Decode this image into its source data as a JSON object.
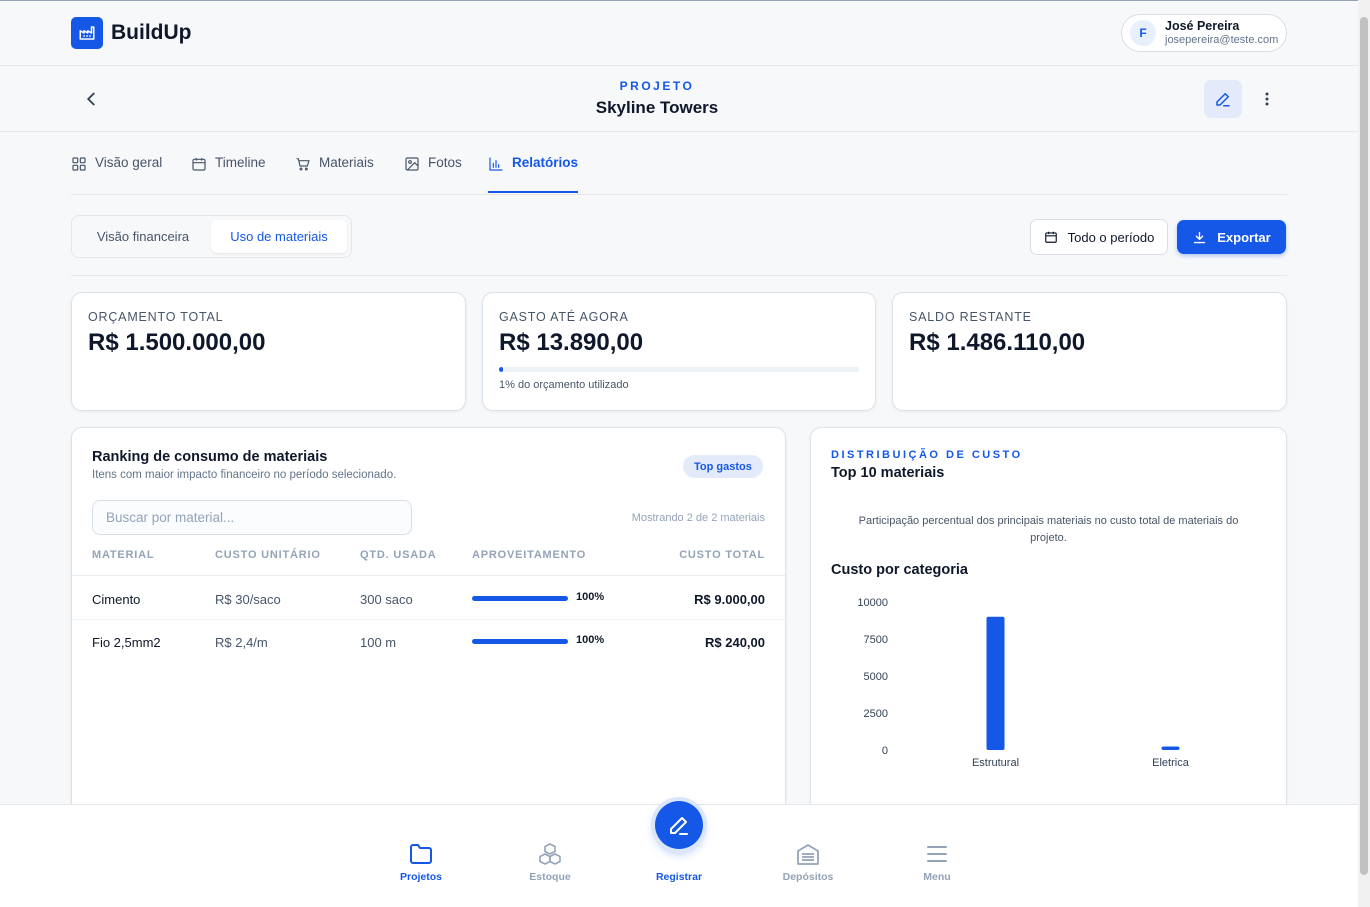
{
  "app": {
    "name": "BuildUp"
  },
  "user": {
    "initial": "F",
    "name": "José Pereira",
    "email": "josepereira@teste.com"
  },
  "project": {
    "label": "PROJETO",
    "name": "Skyline Towers"
  },
  "tabs": [
    {
      "label": "Visão geral",
      "icon": "grid-icon"
    },
    {
      "label": "Timeline",
      "icon": "calendar-icon"
    },
    {
      "label": "Materiais",
      "icon": "cart-icon"
    },
    {
      "label": "Fotos",
      "icon": "image-icon"
    },
    {
      "label": "Relatórios",
      "icon": "bar-chart-icon",
      "active": true
    }
  ],
  "segmented": {
    "options": [
      "Visão financeira",
      "Uso de materiais"
    ],
    "selected": "Uso de materiais"
  },
  "toolbar": {
    "period_label": "Todo o período",
    "export_label": "Exportar"
  },
  "kpis": [
    {
      "label": "ORÇAMENTO TOTAL",
      "value": "R$ 1.500.000,00"
    },
    {
      "label": "GASTO ATÉ AGORA",
      "value": "R$ 13.890,00",
      "progress": 0.01,
      "note": "1% do orçamento utilizado"
    },
    {
      "label": "SALDO RESTANTE",
      "value": "R$ 1.486.110,00"
    }
  ],
  "ranking": {
    "title": "Ranking de consumo de materiais",
    "subtitle": "Itens com maior impacto financeiro no período selecionado.",
    "badge": "Top gastos",
    "search_placeholder": "Buscar por material...",
    "showing": "Mostrando 2 de 2 materiais",
    "columns": [
      "MATERIAL",
      "CUSTO UNITÁRIO",
      "QTD. USADA",
      "APROVEITAMENTO",
      "CUSTO TOTAL"
    ],
    "rows": [
      {
        "material": "Cimento",
        "unit_cost": "R$ 30/saco",
        "qty": "300 saco",
        "usage": 1.0,
        "usage_label": "100%",
        "total": "R$ 9.000,00"
      },
      {
        "material": "Fio 2,5mm2",
        "unit_cost": "R$ 2,4/m",
        "qty": "100 m",
        "usage": 1.0,
        "usage_label": "100%",
        "total": "R$ 240,00"
      }
    ]
  },
  "distribution": {
    "label": "DISTRIBUIÇÃO DE CUSTO",
    "title": "Top 10 materiais",
    "description": "Participação percentual dos principais materiais no custo total de materiais do projeto.",
    "chart_title": "Custo por categoria"
  },
  "chart_data": {
    "type": "bar",
    "title": "Custo por categoria",
    "categories": [
      "Estrutural",
      "Eletrica"
    ],
    "values": [
      9000,
      240
    ],
    "yticks": [
      0,
      2500,
      5000,
      7500,
      10000
    ],
    "ylim": [
      0,
      10000
    ],
    "xlabel": "",
    "ylabel": "",
    "grid": false,
    "color": "#1557e6"
  },
  "bottom_nav": [
    {
      "label": "Projetos",
      "icon": "folder-icon",
      "active": true
    },
    {
      "label": "Estoque",
      "icon": "boxes-icon"
    },
    {
      "label": "Registrar",
      "icon": "pencil-icon",
      "fab": true
    },
    {
      "label": "Depósitos",
      "icon": "warehouse-icon"
    },
    {
      "label": "Menu",
      "icon": "menu-icon"
    }
  ],
  "colors": {
    "accent": "#1557e6",
    "text": "#0f172a",
    "muted": "#64748b"
  }
}
